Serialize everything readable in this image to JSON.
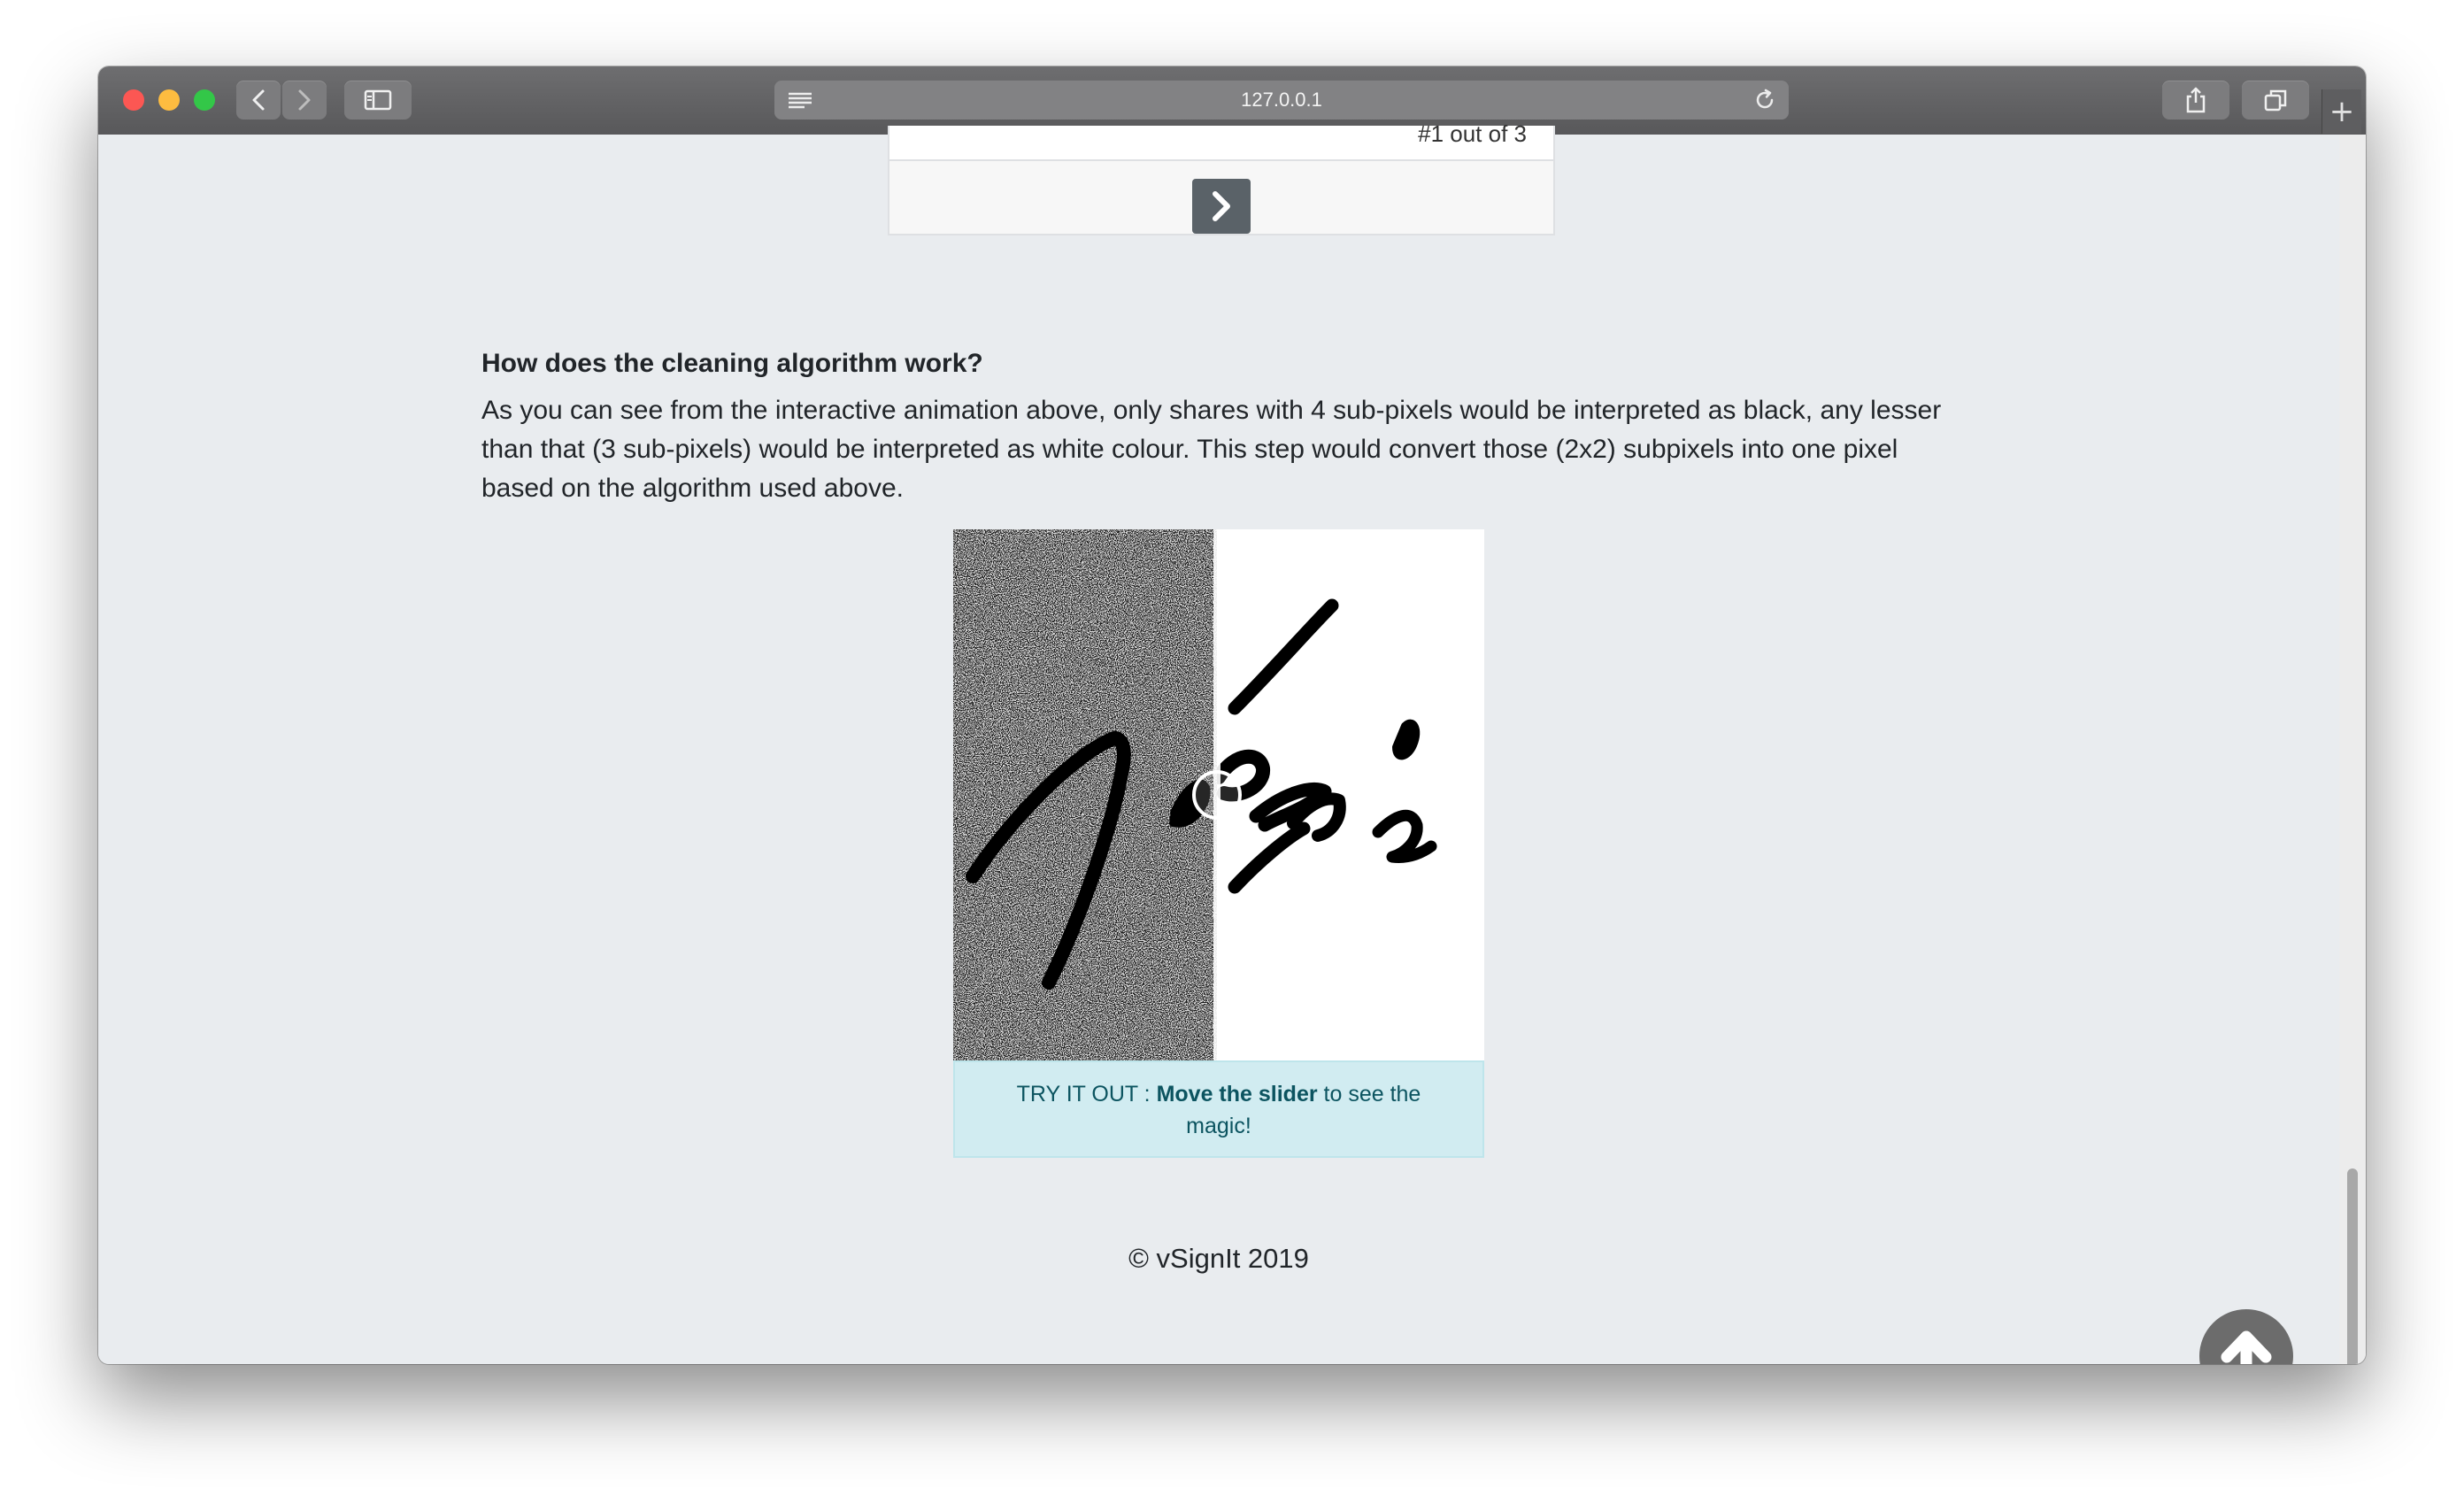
{
  "browser": {
    "address": "127.0.0.1",
    "new_tab_label": "+"
  },
  "carousel": {
    "counter": "#1 out of 3"
  },
  "section": {
    "title": "How does the cleaning algorithm work?",
    "body": "As you can see from the interactive animation above, only shares with 4 sub-pixels would be interpreted as black, any lesser than that (3 sub-pixels) would be interpreted as white colour. This step would convert those (2x2) subpixels into one pixel based on the algorithm used above."
  },
  "comparison": {
    "slider_position": 0.49
  },
  "info": {
    "prefix": "TRY IT OUT : ",
    "emphasis": "Move the slider",
    "suffix": " to see the magic!"
  },
  "footer": {
    "copyright": "© vSignIt 2019"
  },
  "colors": {
    "page_bg": "#e9ecef",
    "info_bg": "#d1ecf1",
    "info_text": "#0c5460",
    "button": "#5a6268"
  },
  "icons": {
    "next": "chevron-right-icon",
    "back_to_top": "arrow-up-circle-icon"
  }
}
